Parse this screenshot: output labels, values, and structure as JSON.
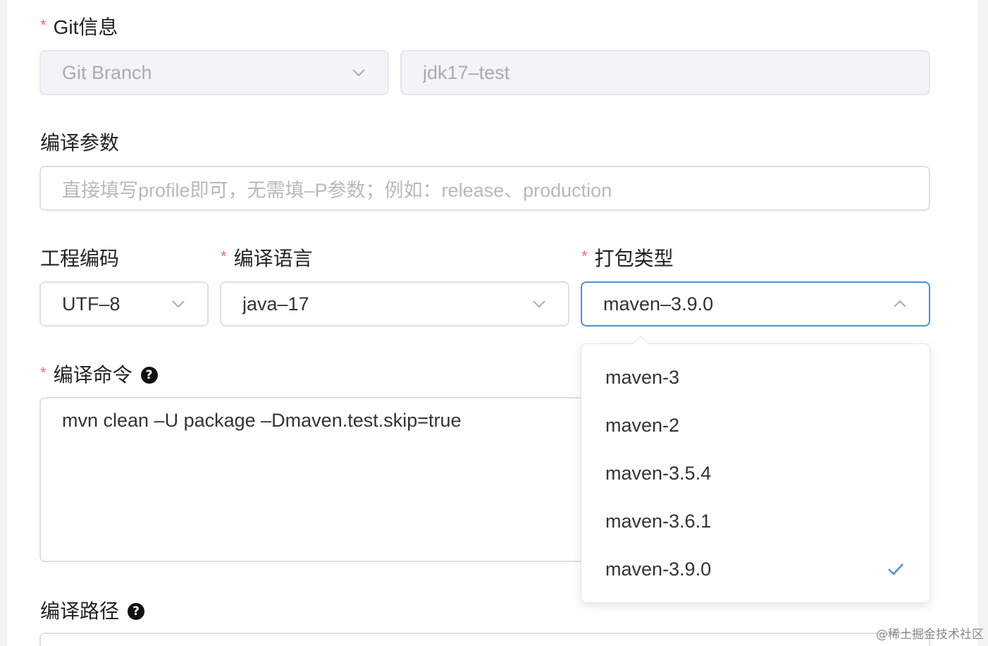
{
  "git_section": {
    "label": "Git信息",
    "required_mark": "*",
    "branch_select": {
      "value": "Git Branch"
    },
    "branch_input": {
      "value": "jdk17–test"
    }
  },
  "compile_params": {
    "label": "编译参数",
    "placeholder": "直接填写profile即可，无需填–P参数；例如：release、production"
  },
  "encoding": {
    "label": "工程编码",
    "value": "UTF–8"
  },
  "language": {
    "label": "编译语言",
    "required_mark": "*",
    "value": "java–17"
  },
  "package_type": {
    "label": "打包类型",
    "required_mark": "*",
    "value": "maven–3.9.0",
    "options": [
      "maven-3",
      "maven-2",
      "maven-3.5.4",
      "maven-3.6.1",
      "maven-3.9.0"
    ],
    "selected_index": 4
  },
  "compile_command": {
    "label": "编译命令",
    "required_mark": "*",
    "help": "?",
    "value": "mvn clean –U package –Dmaven.test.skip=true"
  },
  "compile_path": {
    "label": "编译路径",
    "help": "?"
  },
  "colors": {
    "accent": "#4a90e2",
    "required": "#f56c6c"
  },
  "watermark": "@稀土掘金技术社区"
}
